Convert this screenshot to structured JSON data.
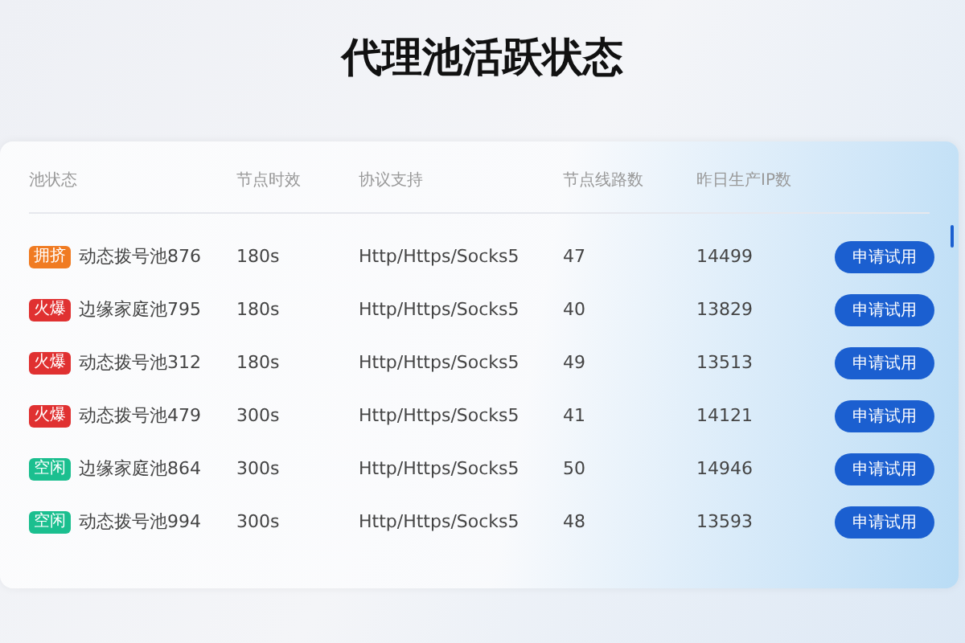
{
  "title": "代理池活跃状态",
  "table": {
    "columns": [
      "池状态",
      "节点时效",
      "协议支持",
      "节点线路数",
      "昨日生产IP数"
    ],
    "rows": [
      {
        "badge": "拥挤",
        "color": "#f07b22",
        "name": "动态拨号池876",
        "ttl": "180s",
        "protocol": "Http/Https/Socks5",
        "lines": "47",
        "ips": "14499",
        "action": "申请试用"
      },
      {
        "badge": "火爆",
        "color": "#e03131",
        "name": "边缘家庭池795",
        "ttl": "180s",
        "protocol": "Http/Https/Socks5",
        "lines": "40",
        "ips": "13829",
        "action": "申请试用"
      },
      {
        "badge": "火爆",
        "color": "#e03131",
        "name": "动态拨号池312",
        "ttl": "180s",
        "protocol": "Http/Https/Socks5",
        "lines": "49",
        "ips": "13513",
        "action": "申请试用"
      },
      {
        "badge": "火爆",
        "color": "#e03131",
        "name": "动态拨号池479",
        "ttl": "300s",
        "protocol": "Http/Https/Socks5",
        "lines": "41",
        "ips": "14121",
        "action": "申请试用"
      },
      {
        "badge": "空闲",
        "color": "#1bbf8f",
        "name": "边缘家庭池864",
        "ttl": "300s",
        "protocol": "Http/Https/Socks5",
        "lines": "50",
        "ips": "14946",
        "action": "申请试用"
      },
      {
        "badge": "空闲",
        "color": "#1bbf8f",
        "name": "动态拨号池994",
        "ttl": "300s",
        "protocol": "Http/Https/Socks5",
        "lines": "48",
        "ips": "13593",
        "action": "申请试用"
      }
    ]
  }
}
